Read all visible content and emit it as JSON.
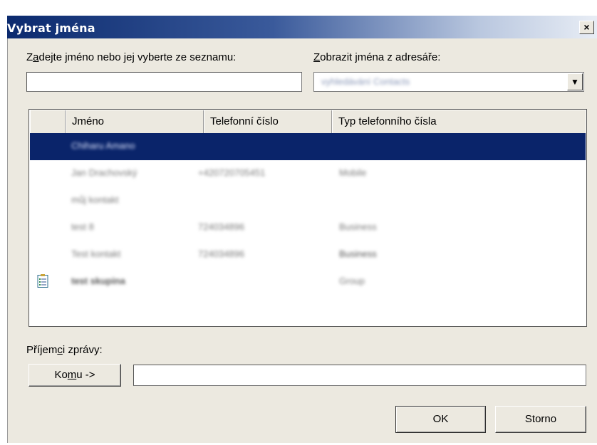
{
  "dialog": {
    "title": "Vybrat jména",
    "close_symbol": "×"
  },
  "search": {
    "label_accel": "a",
    "label_pre": "Z",
    "label_post": "dejte jméno nebo jej vyberte ze seznamu:",
    "value": ""
  },
  "addressbook": {
    "label_accel": "Z",
    "label_post": "obrazit jména z adresáře:",
    "selected": "vyhledávání Contacts",
    "arrow": "▼"
  },
  "columns": [
    "Jméno",
    "Telefonní číslo",
    "Typ telefonního čísla"
  ],
  "rows": [
    {
      "name": "Chiharu Amano",
      "phone": "",
      "type": "",
      "selected": true,
      "group": false
    },
    {
      "name": "Jan Drachovský",
      "phone": "+420720705451",
      "type": "Mobile",
      "selected": false,
      "group": false
    },
    {
      "name": "můj kontakt",
      "phone": "",
      "type": "",
      "selected": false,
      "group": false
    },
    {
      "name": "test 8",
      "phone": "724034896",
      "type": "Business",
      "selected": false,
      "group": false
    },
    {
      "name": "Test kontakt",
      "phone": "724034896",
      "type": "Business",
      "selected": false,
      "group": false
    },
    {
      "name": "test skupina",
      "phone": "",
      "type": "Group",
      "selected": false,
      "group": true
    }
  ],
  "recipients": {
    "label_pre": "Příjem",
    "label_accel": "c",
    "label_post": "i zprávy:",
    "to_button_pre": "Ko",
    "to_button_accel": "m",
    "to_button_post": "u ->",
    "to_value": ""
  },
  "buttons": {
    "ok": "OK",
    "cancel": "Storno"
  }
}
